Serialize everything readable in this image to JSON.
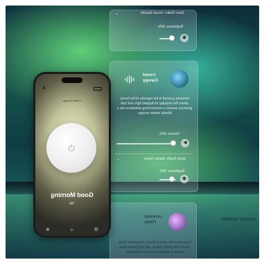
{
  "top_panel": {
    "label_mirrored": "Sonic Radio: Ocean Sounds",
    "brightness_mirrored": "Brightness: 50%"
  },
  "mid_panel": {
    "title_mirrored": "Forest Canopy",
    "description_mirrored": "Immerse yourself in the tapestry of the forest, where the interplay of dappled light and lush greenery weaves a mesmerizing ambiance into a blissful nature escape.",
    "volume_mirrored": "Volume: 60%",
    "radio_label_mirrored": "Sonic Radio: Station Home",
    "brightness_mirrored": "Brightness: 30%"
  },
  "bottom_panel": {
    "title_mirrored": "Lavender Fields",
    "description_mirrored": "Experience the serene beauty of lavender fields, where the gentle breeze and soft purple hues create a tranquil retreat for relaxation."
  },
  "overlay_label_mirrored": "AURORA SUNRISE",
  "phone": {
    "status_letter": "A",
    "header": "Forest Canopy",
    "greeting": "Good Morning",
    "temperature": "68°",
    "tab_left": "⊕",
    "tab_home": "⌂",
    "tab_right": "⚙"
  },
  "icons": {
    "power": "power-icon",
    "sun": "sun-icon",
    "waveform": "waveform-icon"
  }
}
